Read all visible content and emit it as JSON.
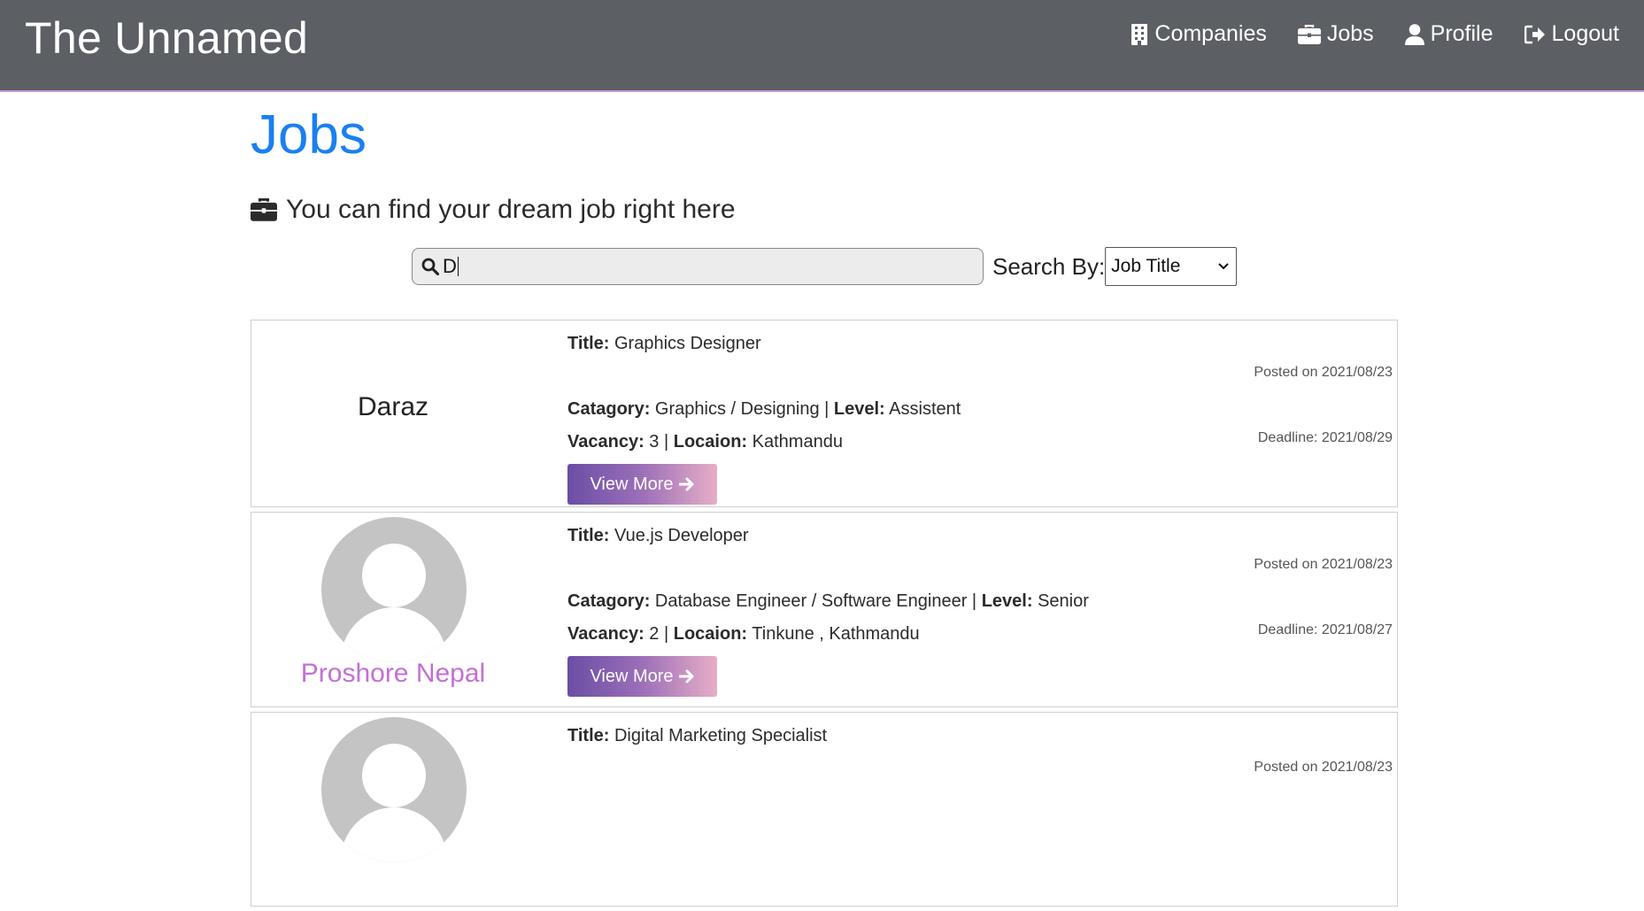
{
  "navbar": {
    "brand": "The Unnamed",
    "links": [
      {
        "label": "Companies",
        "icon": "building-icon"
      },
      {
        "label": "Jobs",
        "icon": "briefcase-icon"
      },
      {
        "label": "Profile",
        "icon": "user-icon"
      },
      {
        "label": "Logout",
        "icon": "logout-icon"
      }
    ],
    "border_color": "#c79be0"
  },
  "page": {
    "title": "Jobs",
    "subtitle": "You can find your dream job right here",
    "title_color": "#1a7ff2"
  },
  "search": {
    "value": "D",
    "label": "Search By:",
    "selected_option": "Job Title"
  },
  "jobs": [
    {
      "company": "Daraz",
      "has_avatar": false,
      "title_label": "Title:",
      "title": "Graphics Designer",
      "category_label": "Catagory:",
      "category": "Graphics / Designing",
      "level_label": "Level:",
      "level": "Assistent",
      "vacancy_label": "Vacancy:",
      "vacancy": "3",
      "location_label": "Locaion:",
      "location": "Kathmandu",
      "posted": "Posted on 2021/08/23",
      "deadline": "Deadline: 2021/08/29",
      "button": "View More"
    },
    {
      "company": "Proshore Nepal",
      "has_avatar": true,
      "title_label": "Title:",
      "title": "Vue.js Developer",
      "category_label": "Catagory:",
      "category": "Database Engineer / Software Engineer",
      "level_label": "Level:",
      "level": "Senior",
      "vacancy_label": "Vacancy:",
      "vacancy": "2",
      "location_label": "Locaion:",
      "location": "Tinkune , Kathmandu",
      "posted": "Posted on 2021/08/23",
      "deadline": "Deadline: 2021/08/27",
      "button": "View More"
    },
    {
      "company": "",
      "has_avatar": true,
      "title_label": "Title:",
      "title": "Digital Marketing Specialist",
      "posted": "Posted on 2021/08/23"
    }
  ],
  "colors": {
    "navbar_bg": "#5c5f64",
    "company_link": "#c46fd6",
    "button_gradient": [
      "#6a4ea4",
      "#e7aec6"
    ]
  }
}
